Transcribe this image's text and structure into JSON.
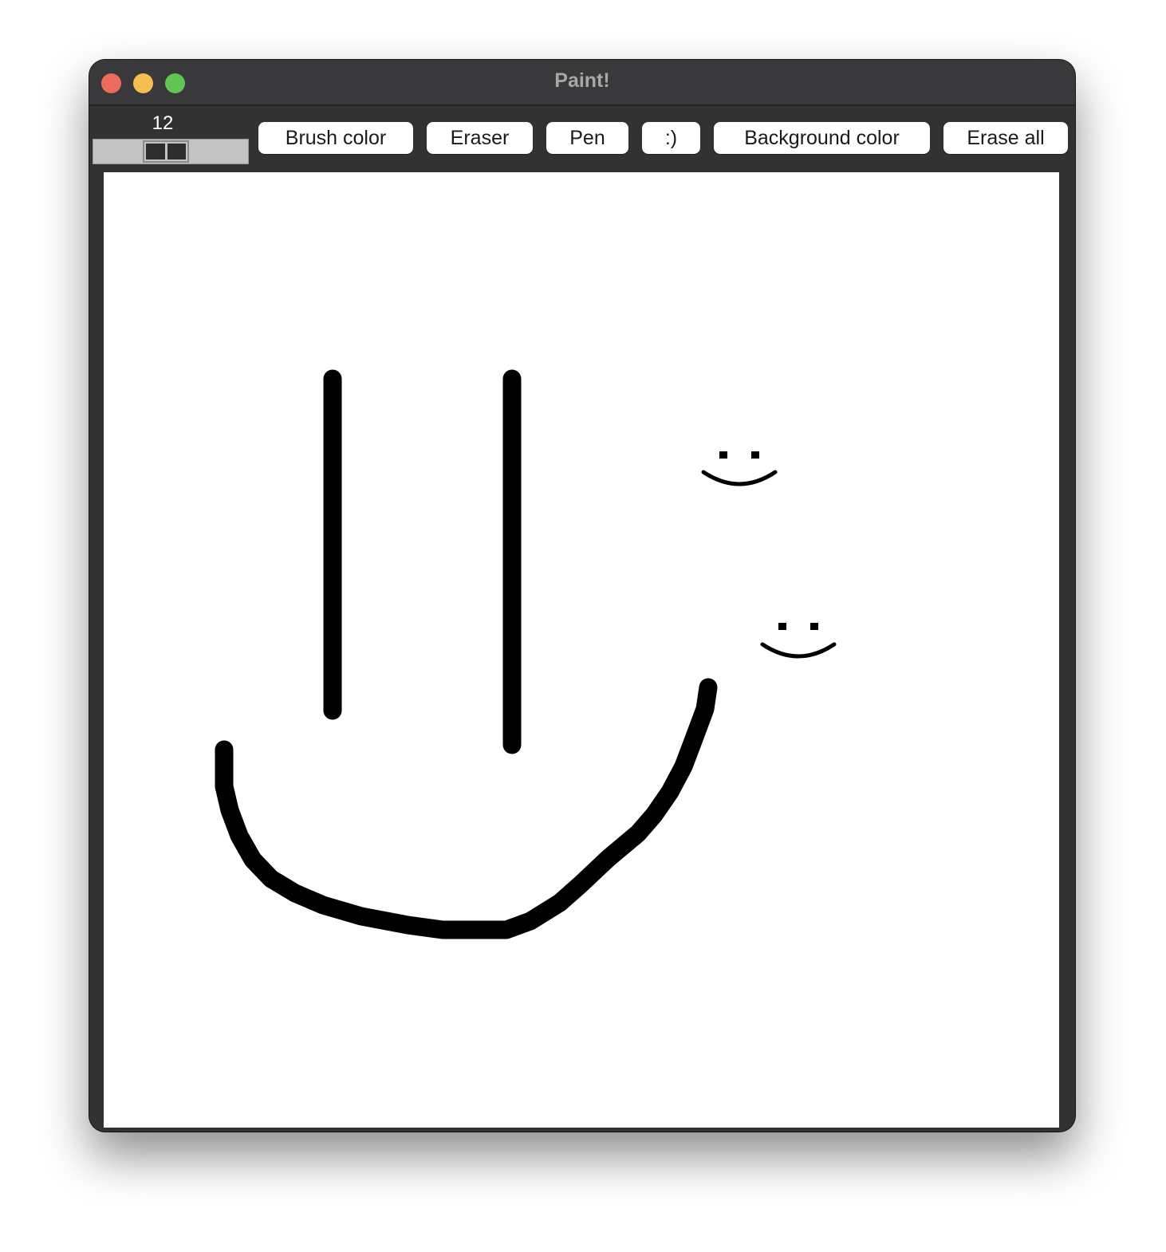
{
  "window": {
    "title": "Paint!"
  },
  "toolbar": {
    "brush_size": "12",
    "buttons": {
      "brush_color": "Brush color",
      "eraser": "Eraser",
      "pen": "Pen",
      "smiley": ":)",
      "background_color": "Background color",
      "erase_all": "Erase all"
    }
  },
  "canvas": {
    "background": "#ffffff",
    "stroke_color": "#000000"
  },
  "colors": {
    "close": "#ed6a5e",
    "minimize": "#f5bf4f",
    "maximize": "#61c554",
    "window_chrome": "#323232"
  }
}
